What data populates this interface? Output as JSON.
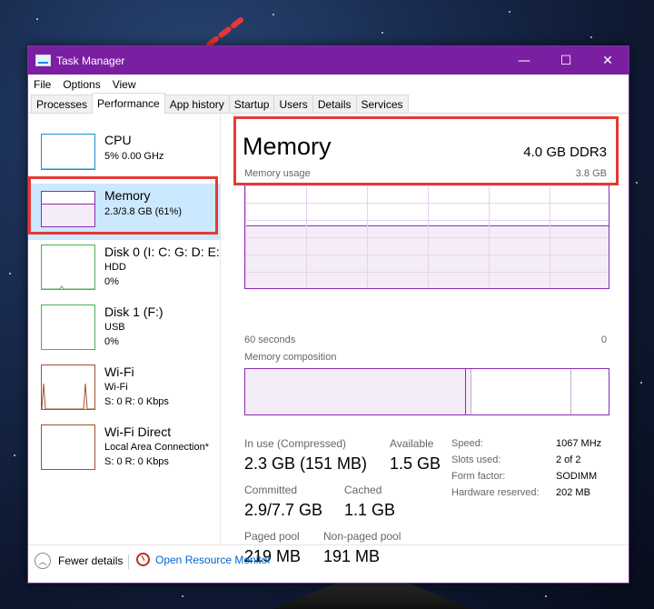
{
  "window": {
    "title": "Task Manager",
    "controls": {
      "minimize": "—",
      "maximize": "☐",
      "close": "✕"
    }
  },
  "menu": [
    "File",
    "Options",
    "View"
  ],
  "tabs": [
    "Processes",
    "Performance",
    "App history",
    "Startup",
    "Users",
    "Details",
    "Services"
  ],
  "active_tab": "Performance",
  "sidebar": {
    "items": [
      {
        "name": "CPU",
        "line1": "5%  0.00 GHz",
        "line2": ""
      },
      {
        "name": "Memory",
        "line1": "2.3/3.8 GB (61%)",
        "line2": ""
      },
      {
        "name": "Disk 0 (I: C: G: D: E:",
        "line1": "HDD",
        "line2": "0%"
      },
      {
        "name": "Disk 1 (F:)",
        "line1": "USB",
        "line2": "0%"
      },
      {
        "name": "Wi-Fi",
        "line1": "Wi-Fi",
        "line2": "S: 0 R: 0 Kbps"
      },
      {
        "name": "Wi-Fi Direct",
        "line1": "Local Area Connection*",
        "line2": "S: 0 R: 0 Kbps"
      }
    ],
    "selected": "Memory"
  },
  "memory": {
    "title": "Memory",
    "capacity": "4.0 GB DDR3",
    "usage_label": "Memory usage",
    "usage_max": "3.8 GB",
    "usage_level": 0.61,
    "time_label": "60 seconds",
    "time_min": "0",
    "composition_label": "Memory composition",
    "stats": {
      "in_use_label": "In use (Compressed)",
      "in_use": "2.3 GB (151 MB)",
      "available_label": "Available",
      "available": "1.5 GB",
      "committed_label": "Committed",
      "committed": "2.9/7.7 GB",
      "cached_label": "Cached",
      "cached": "1.1 GB",
      "paged_label": "Paged pool",
      "paged": "219 MB",
      "nonpaged_label": "Non-paged pool",
      "nonpaged": "191 MB"
    },
    "details": [
      {
        "label": "Speed:",
        "value": "1067 MHz"
      },
      {
        "label": "Slots used:",
        "value": "2 of 2"
      },
      {
        "label": "Form factor:",
        "value": "SODIMM"
      },
      {
        "label": "Hardware reserved:",
        "value": "202 MB"
      }
    ]
  },
  "footer": {
    "fewer_details": "Fewer details",
    "resource_monitor": "Open Resource Monitor"
  },
  "colors": {
    "titlebar": "#7b1fa2",
    "memory_accent": "#8a2cb4",
    "cpu_accent": "#1a8fd6",
    "disk_accent": "#4caf50",
    "wifi_accent": "#a0522d",
    "highlight": "#e53935",
    "selected_bg": "#cce8ff"
  }
}
